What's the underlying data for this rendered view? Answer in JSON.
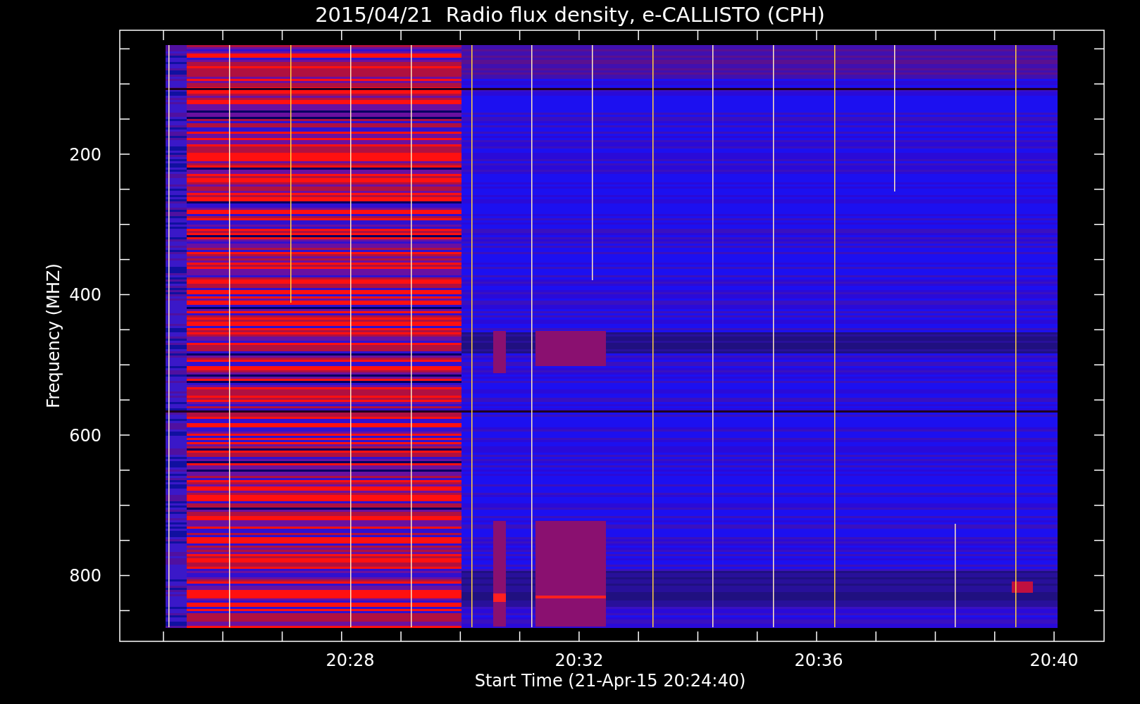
{
  "chart": {
    "title": "2015/04/21  Radio flux density, e-CALLISTO (CPH)",
    "y_axis": {
      "label": "Frequency (MHZ)",
      "ticks": [
        "200",
        "400",
        "600",
        "800"
      ]
    },
    "x_axis": {
      "label": "Start Time (21-Apr-15 20:24:40)",
      "ticks": [
        "20:28",
        "20:32",
        "20:36",
        "20:40"
      ]
    }
  }
}
